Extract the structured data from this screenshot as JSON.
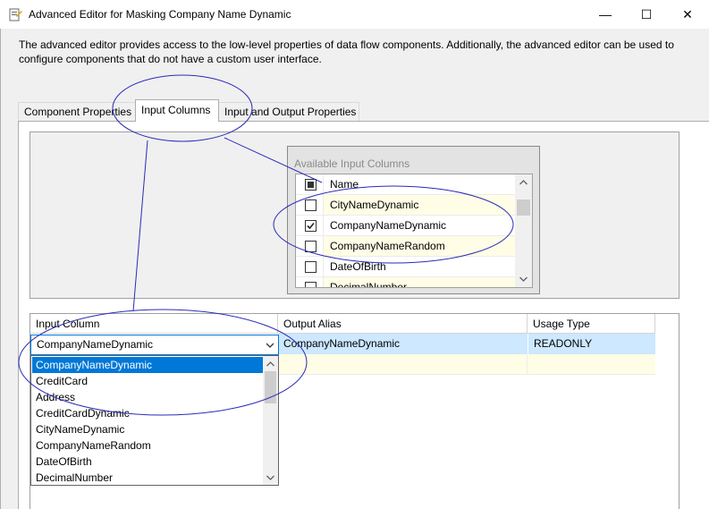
{
  "window": {
    "title": "Advanced Editor for Masking Company Name Dynamic",
    "minimize_glyph": "—",
    "maximize_glyph": "☐",
    "close_glyph": "✕"
  },
  "description": "The advanced editor provides access to the low-level properties of data flow components. Additionally, the advanced editor can be used to configure components that do not have a custom user interface.",
  "tabs": [
    {
      "label": "Component Properties"
    },
    {
      "label": "Input Columns"
    },
    {
      "label": "Input and Output Properties"
    }
  ],
  "available_columns": {
    "title": "Available Input Columns",
    "header": "Name",
    "rows": [
      {
        "name": "CityNameDynamic",
        "checked": false
      },
      {
        "name": "CompanyNameDynamic",
        "checked": true
      },
      {
        "name": "CompanyNameRandom",
        "checked": false
      },
      {
        "name": "DateOfBirth",
        "checked": false
      },
      {
        "name": "DecimalNumber",
        "checked": false
      }
    ]
  },
  "grid": {
    "headers": {
      "input": "Input Column",
      "alias": "Output Alias",
      "usage": "Usage Type"
    },
    "row": {
      "input": "CompanyNameDynamic",
      "alias": "CompanyNameDynamic",
      "usage": "READONLY"
    }
  },
  "dropdown": {
    "items": [
      "CompanyNameDynamic",
      "CreditCard",
      "Address",
      "CreditCardDynamic",
      "CityNameDynamic",
      "CompanyNameRandom",
      "DateOfBirth",
      "DecimalNumber"
    ],
    "selected_index": 0
  },
  "colors": {
    "selection": "#0078d7",
    "row_highlight": "#cde8ff",
    "cell_yellow": "#fffde6",
    "annotation": "#2b2bb8"
  },
  "icons": {
    "app": "ssis-editor-icon",
    "check": "check-icon",
    "dropdown": "chevron-down-icon",
    "scroll_up": "chevron-up-icon",
    "scroll_down": "chevron-down-icon"
  }
}
